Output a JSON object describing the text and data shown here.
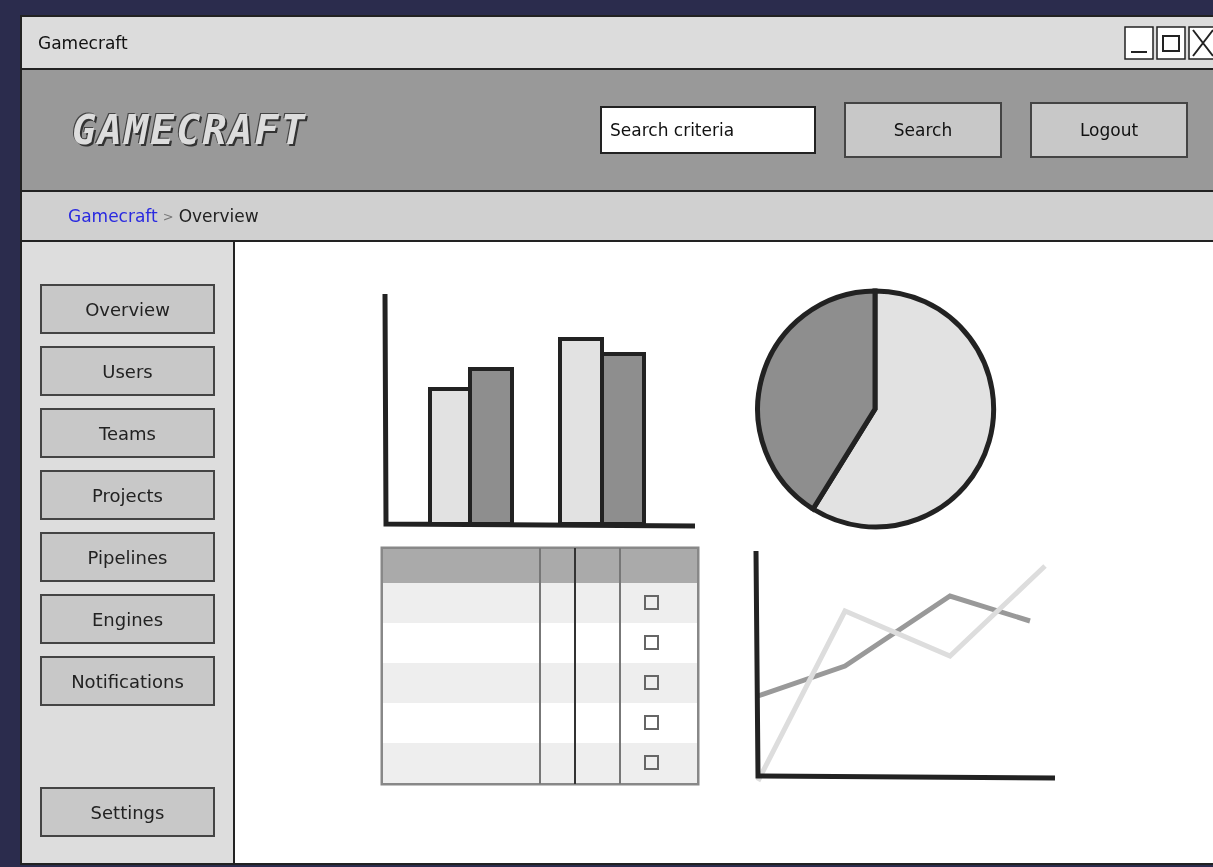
{
  "window": {
    "title": "Gamecraft"
  },
  "header": {
    "logo": "GAMECRAFT",
    "search": {
      "value": "Search criteria"
    },
    "buttons": [
      "Search",
      "Logout"
    ]
  },
  "breadcrumb": {
    "link": "Gamecraft",
    "separator": ">",
    "current": "Overview"
  },
  "sidebar": {
    "items": [
      "Overview",
      "Users",
      "Teams",
      "Projects",
      "Pipelines",
      "Engines",
      "Notifications"
    ],
    "footer_item": "Settings"
  }
}
